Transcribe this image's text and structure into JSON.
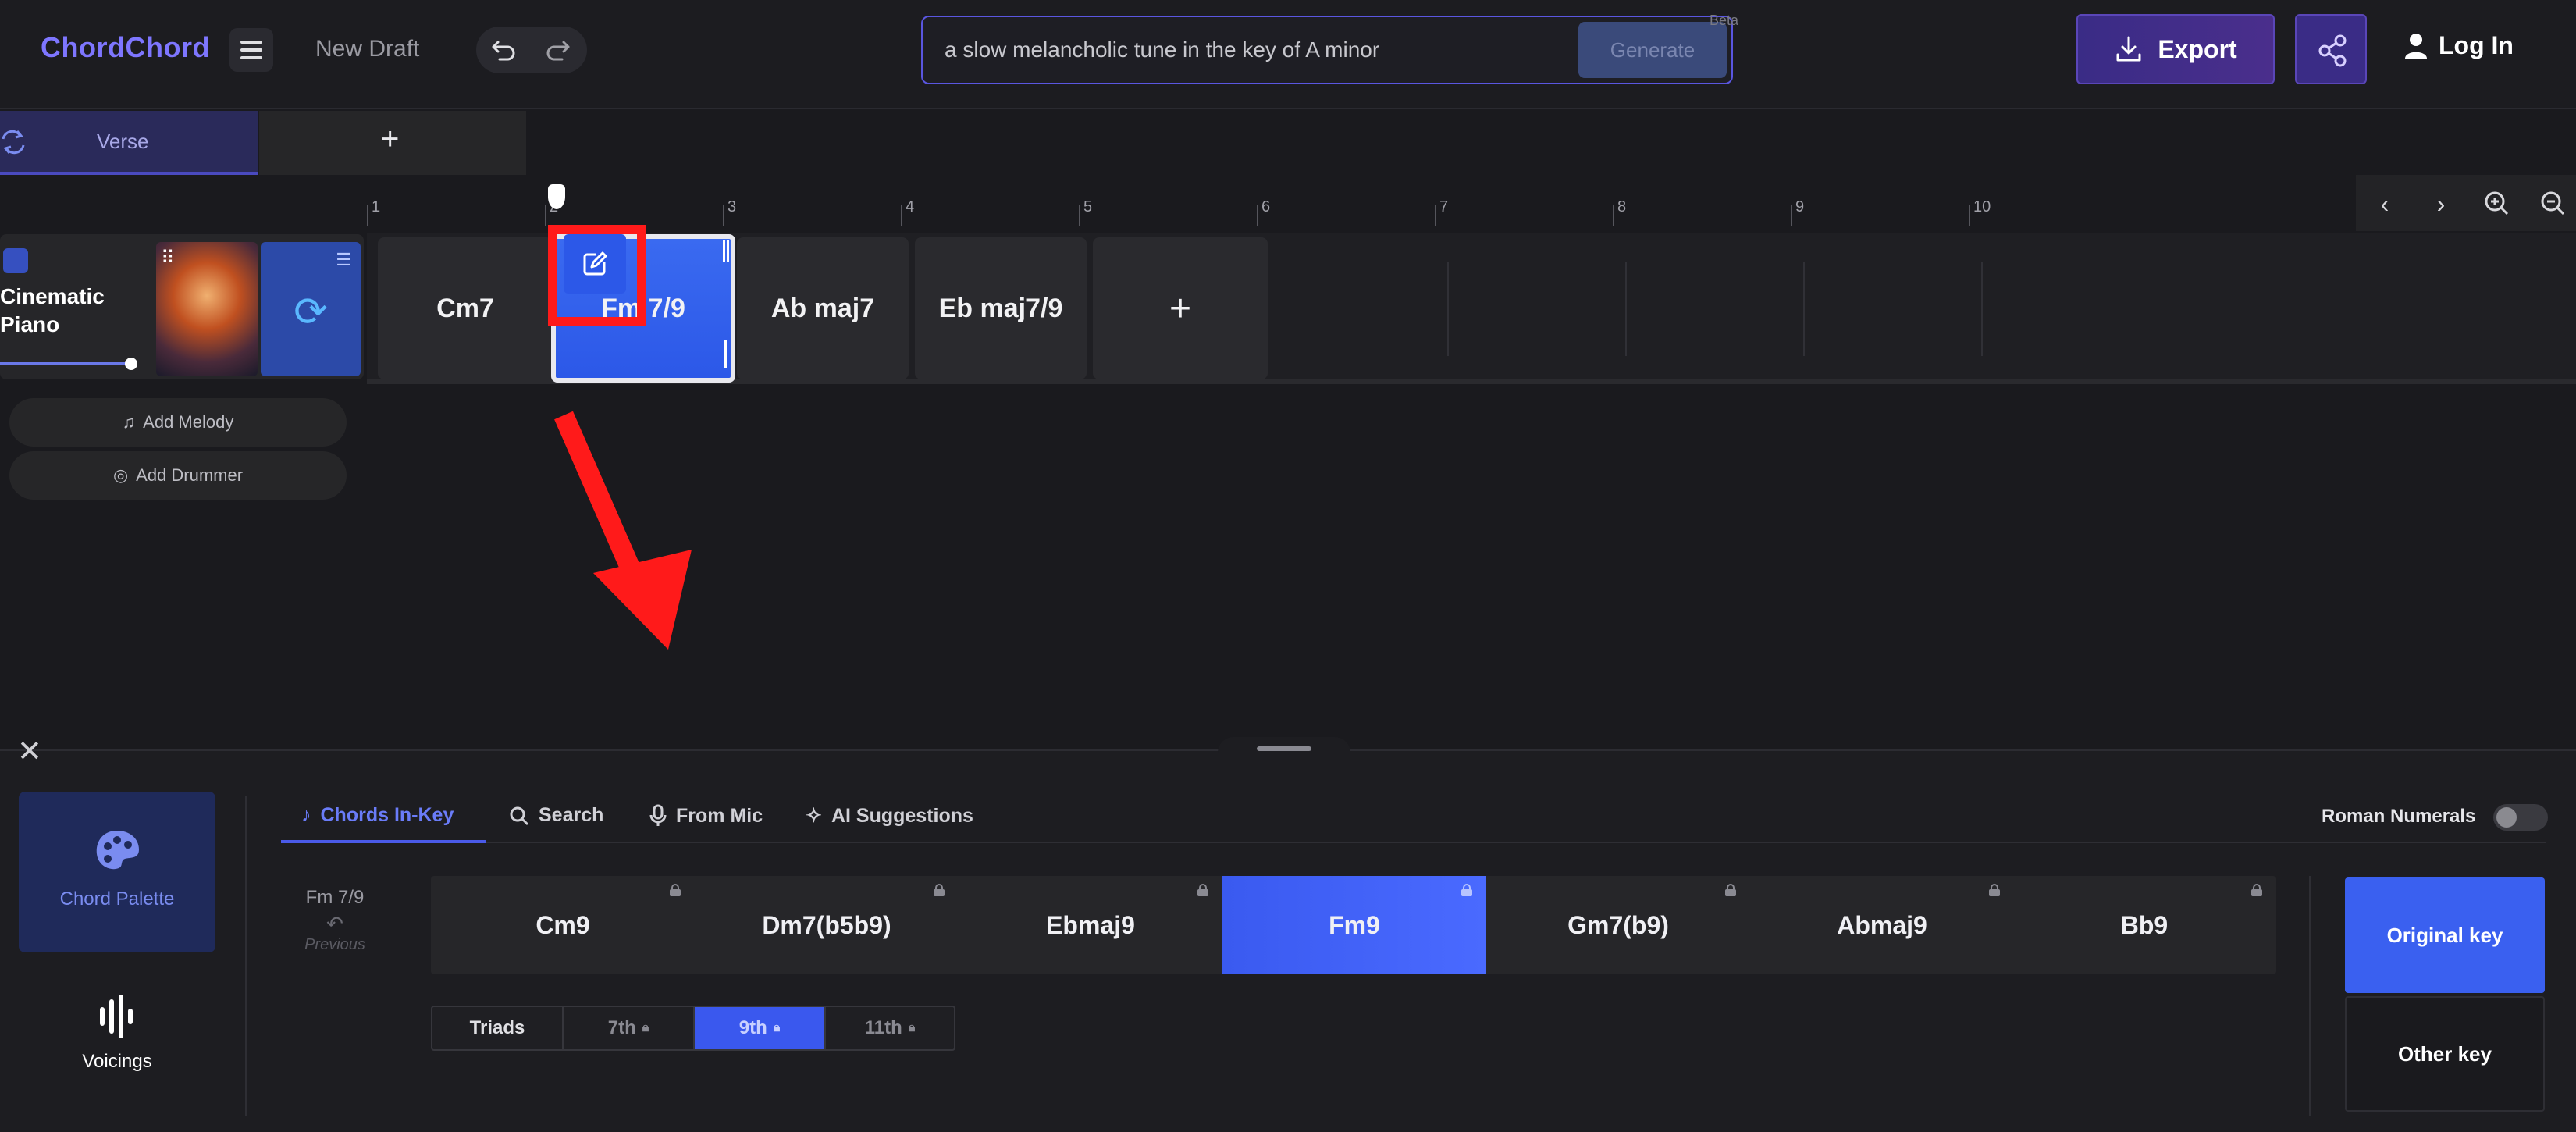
{
  "app": {
    "logo": "ChordChord",
    "draft": "New Draft",
    "prompt_value": "a slow melancholic tune in the key of A minor",
    "generate_label": "Generate",
    "beta_label": "Beta",
    "export_label": "Export",
    "login_label": "Log In"
  },
  "sections": {
    "active": "Verse",
    "add": "+"
  },
  "ruler": [
    "1",
    "2",
    "3",
    "4",
    "5",
    "6",
    "7",
    "8",
    "9",
    "10"
  ],
  "track": {
    "instrument": "Cinematic Piano",
    "add_melody": "Add Melody",
    "add_drummer": "Add Drummer",
    "chords": [
      "Cm7",
      "Fm 7/9",
      "Ab maj7",
      "Eb maj7/9"
    ],
    "add_chord": "+"
  },
  "panel": {
    "palette_label": "Chord Palette",
    "voicings_label": "Voicings",
    "tabs": [
      "Chords In-Key",
      "Search",
      "From Mic",
      "AI Suggestions"
    ],
    "roman_label": "Roman Numerals",
    "current_chord": "Fm 7/9",
    "previous_label": "Previous",
    "key_chords": [
      "Cm9",
      "Dm7(b5b9)",
      "Ebmaj9",
      "Fm9",
      "Gm7(b9)",
      "Abmaj9",
      "Bb9"
    ],
    "selected_key_chord": "Fm9",
    "extensions": [
      "Triads",
      "7th",
      "9th",
      "11th"
    ],
    "selected_extension": "9th",
    "original_key": "Original key",
    "other_key": "Other key"
  },
  "colors": {
    "accent": "#3a60f0",
    "brand": "#7e76ff",
    "highlight": "#ff1a1a"
  }
}
